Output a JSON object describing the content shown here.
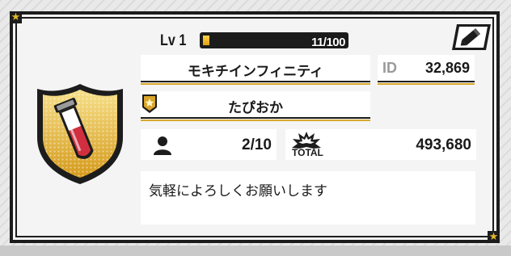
{
  "profile": {
    "level_label": "Lv 1",
    "xp_text": "11/100",
    "xp_fraction": 0.11,
    "name": "モキチインフィニティ",
    "id_label": "ID",
    "id_value": "32,869",
    "title": "たぴおか",
    "members_value": "2/10",
    "total_label": "TOTAL",
    "total_value": "493,680",
    "message": "気軽によろしくお願いします"
  },
  "icons": {
    "edit": "pencil-icon",
    "emblem": "test-tube-shield-emblem",
    "rank": "star-rank-badge-icon",
    "members": "person-icon",
    "total": "burst-icon",
    "corner": "star-icon"
  },
  "colors": {
    "accent_gold": "#e2a113",
    "frame": "#1c1c1c",
    "underline": "#d9a82a"
  }
}
